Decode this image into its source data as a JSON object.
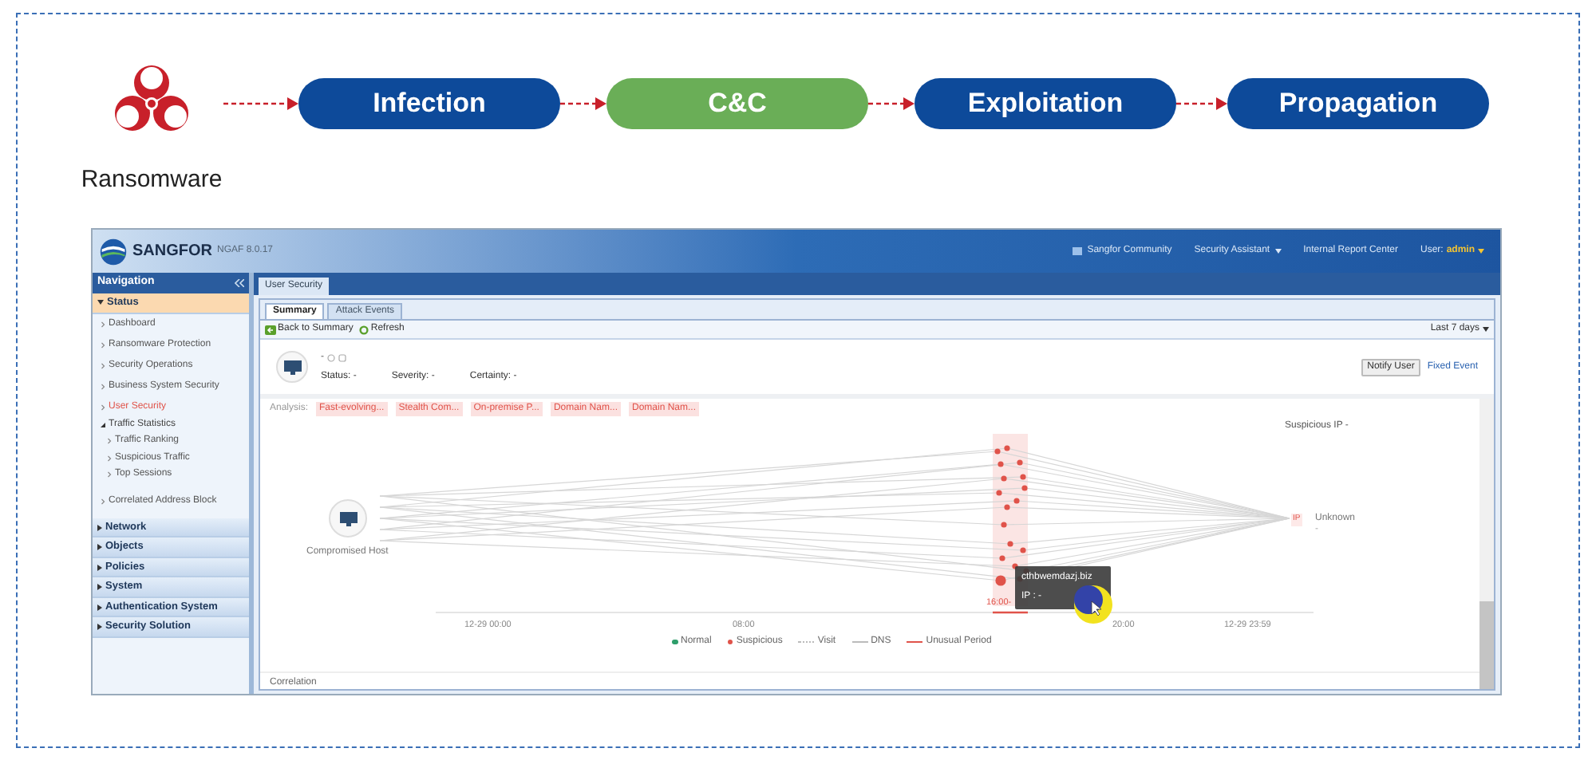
{
  "flow": {
    "source": {
      "label": "Ransomware"
    },
    "stages": [
      {
        "label": "Infection",
        "color": "#0d4a9a"
      },
      {
        "label": "C&C",
        "color": "#6aae57"
      },
      {
        "label": "Exploitation",
        "color": "#0d4a9a"
      },
      {
        "label": "Propagation",
        "color": "#0d4a9a"
      }
    ]
  },
  "app": {
    "header": {
      "brand": "SANGFOR",
      "version": "NGAF 8.0.17",
      "links": [
        {
          "label": "Sangfor Community",
          "kind": "icon-link"
        },
        {
          "label": "Security Assistant",
          "kind": "menu"
        },
        {
          "label": "Internal Report Center",
          "kind": "link"
        }
      ],
      "user_label": "User:",
      "user_name": "admin"
    },
    "navigation": {
      "title": "Navigation",
      "sections": [
        {
          "label": "Status",
          "expanded": true,
          "children": [
            {
              "label": "Dashboard",
              "selected": false
            },
            {
              "label": "Ransomware Protection",
              "selected": false
            },
            {
              "label": "Security Operations",
              "selected": false
            },
            {
              "label": "Business System Security",
              "selected": false
            },
            {
              "label": "User Security",
              "selected": true
            },
            {
              "label": "Traffic Statistics",
              "expanded": true,
              "children": [
                {
                  "label": "Traffic Ranking",
                  "selected": false
                },
                {
                  "label": "Suspicious Traffic",
                  "selected": false
                },
                {
                  "label": "Top Sessions",
                  "selected": false
                }
              ]
            },
            {
              "label": "Correlated Address Block",
              "selected": false
            }
          ]
        },
        {
          "label": "Network",
          "expanded": false
        },
        {
          "label": "Objects",
          "expanded": false
        },
        {
          "label": "Policies",
          "expanded": false
        },
        {
          "label": "System",
          "expanded": false
        },
        {
          "label": "Authentication System",
          "expanded": false
        },
        {
          "label": "Security Solution",
          "expanded": false
        }
      ]
    },
    "page_tab": {
      "label": "User Security"
    },
    "tabs": [
      {
        "label": "Summary",
        "selected": true
      },
      {
        "label": "Attack Events",
        "selected": false
      }
    ],
    "toolbar": {
      "buttons": [
        {
          "label": "Back to Summary",
          "kind": "back"
        },
        {
          "label": "Refresh",
          "kind": "refresh"
        }
      ],
      "range": "Last 7 days"
    },
    "host": {
      "name": "-",
      "status": "Status: -",
      "severity": "Severity: -",
      "certainty": "Certainty: -",
      "actions": [
        {
          "label": "Notify User",
          "kind": "button"
        },
        {
          "label": "Fixed Event",
          "kind": "link"
        }
      ]
    },
    "analysis": {
      "label": "Analysis:",
      "tags": [
        "Fast-evolving...",
        "Stealth Com...",
        "On-premise P...",
        "Domain Nam...",
        "Domain Nam..."
      ]
    },
    "graph": {
      "suspicious_ip": "Suspicious IP -",
      "host_label": "Compromised Host",
      "ip_badge": "IP",
      "ip_label": "Unknown",
      "ip_sub": "-",
      "axis_labels": [
        "12-29 00:00",
        "08:00",
        "16:00-",
        "20:00",
        "12-29 23:59"
      ],
      "legend": [
        {
          "label": "Normal",
          "kind": "dot",
          "color": "#2e9e6b"
        },
        {
          "label": "Suspicious",
          "kind": "dot",
          "color": "#e0534a"
        },
        {
          "label": "Visit",
          "kind": "dotted",
          "color": "#bbbbbb"
        },
        {
          "label": "DNS",
          "kind": "line",
          "color": "#bbbbbb"
        },
        {
          "label": "Unusual Period",
          "kind": "line",
          "color": "#e0534a"
        }
      ],
      "tooltip": {
        "title": "cthbwemdazj.biz",
        "ip": "IP : -"
      }
    },
    "footer": {
      "title": "Correlation"
    }
  }
}
